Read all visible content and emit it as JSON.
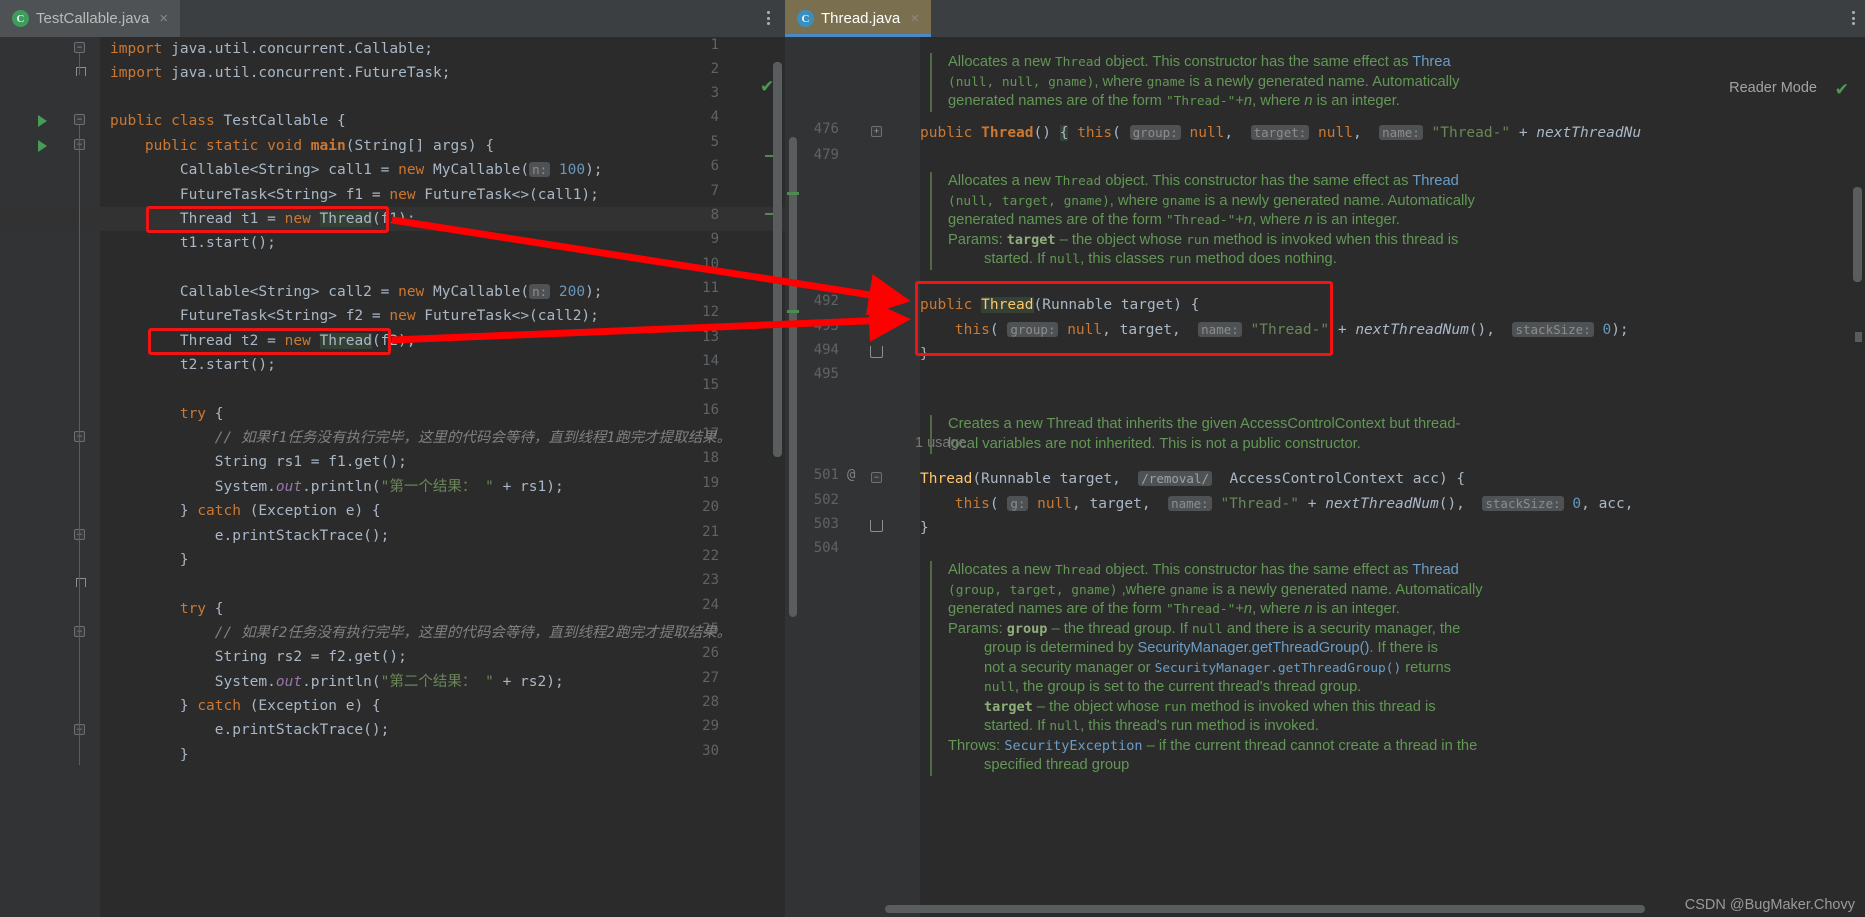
{
  "window": {
    "left_tab": {
      "label": "TestCallable.java",
      "icon": "java-class-icon",
      "close": "×"
    },
    "right_tab": {
      "label": "Thread.java",
      "icon": "java-class-icon",
      "close": "×"
    },
    "reader_mode_label": "Reader Mode",
    "inspection_ok_icon": "✔",
    "watermark": "CSDN @BugMaker.Chovy"
  },
  "left_editor": {
    "lines": [
      {
        "n": "1",
        "text": "import java.util.concurrent.Callable;"
      },
      {
        "n": "2",
        "text": "import java.util.concurrent.FutureTask;"
      },
      {
        "n": "3",
        "text": ""
      },
      {
        "n": "4",
        "text": "public class TestCallable {"
      },
      {
        "n": "5",
        "text": "    public static void main(String[] args) {"
      },
      {
        "n": "6",
        "text": "        Callable<String> call1 = new MyCallable( n: 100);"
      },
      {
        "n": "7",
        "text": "        FutureTask<String> f1 = new FutureTask<>(call1);"
      },
      {
        "n": "8",
        "text": "        Thread t1 = new Thread(f1);"
      },
      {
        "n": "9",
        "text": "        t1.start();"
      },
      {
        "n": "10",
        "text": ""
      },
      {
        "n": "11",
        "text": "        Callable<String> call2 = new MyCallable( n: 200);"
      },
      {
        "n": "12",
        "text": "        FutureTask<String> f2 = new FutureTask<>(call2);"
      },
      {
        "n": "13",
        "text": "        Thread t2 = new Thread(f2);"
      },
      {
        "n": "14",
        "text": "        t2.start();"
      },
      {
        "n": "15",
        "text": ""
      },
      {
        "n": "16",
        "text": "        try {"
      },
      {
        "n": "17",
        "text": "            // 如果f1任务没有执行完毕，这里的代码会等待，直到线程1跑完才提取结果。"
      },
      {
        "n": "18",
        "text": "            String rs1 = f1.get();"
      },
      {
        "n": "19",
        "text": "            System.out.println(\"第一个结果： \" + rs1);"
      },
      {
        "n": "20",
        "text": "        } catch (Exception e) {"
      },
      {
        "n": "21",
        "text": "            e.printStackTrace();"
      },
      {
        "n": "22",
        "text": "        }"
      },
      {
        "n": "23",
        "text": ""
      },
      {
        "n": "24",
        "text": "        try {"
      },
      {
        "n": "25",
        "text": "            // 如果f2任务没有执行完毕，这里的代码会等待，直到线程2跑完才提取结果。"
      },
      {
        "n": "26",
        "text": "            String rs2 = f2.get();"
      },
      {
        "n": "27",
        "text": "            System.out.println(\"第二个结果： \" + rs2);"
      },
      {
        "n": "28",
        "text": "        } catch (Exception e) {"
      },
      {
        "n": "29",
        "text": "            e.printStackTrace();"
      },
      {
        "n": "30",
        "text": "        }"
      }
    ]
  },
  "right_editor": {
    "line_numbers": [
      "476",
      "479",
      "492",
      "493",
      "494",
      "495",
      "501",
      "502",
      "503",
      "504"
    ],
    "code_lines": {
      "476": "public Thread() { this( group: null,  target: null,  name: \"Thread-\" + nextThreadNu",
      "492": "public Thread(Runnable target) {",
      "493": "    this( group: null, target,  name: \"Thread-\" + nextThreadNum(),  stackSize: 0);",
      "494": "}",
      "501": "Thread(Runnable target,  /removal/  AccessControlContext acc) {",
      "502": "    this( g: null, target,  name: \"Thread-\" + nextThreadNum(),  stackSize: 0, acc,",
      "503": "}"
    },
    "docs": [
      {
        "id": "doc-1",
        "lines": [
          "Allocates a new Thread object. This constructor has the same effect as Thread",
          "(null, null, gname), where gname is a newly generated name. Automatically",
          "generated names are of the form \"Thread-\"+n, where n is an integer."
        ]
      },
      {
        "id": "doc-2",
        "lines": [
          "Allocates a new Thread object. This constructor has the same effect as Thread",
          "(null, target, gname), where gname is a newly generated name. Automatically",
          "generated names are of the form \"Thread-\"+n, where n is an integer.",
          "Params: target – the object whose run method is invoked when this thread is",
          "started. If null, this classes run method does nothing."
        ]
      },
      {
        "id": "doc-3",
        "lines": [
          "Creates a new Thread that inherits the given AccessControlContext but thread-",
          "local variables are not inherited. This is not a public constructor."
        ]
      },
      {
        "id": "doc-4",
        "lines": [
          "Allocates a new Thread object. This constructor has the same effect as Thread",
          "(group, target, gname) ,where gname is a newly generated name. Automatically",
          "generated names are of the form \"Thread-\"+n, where n is an integer.",
          "Params: group – the thread group. If null and there is a security manager, the",
          "group is determined by SecurityManager.getThreadGroup(). If there is",
          "not a security manager or SecurityManager.getThreadGroup() returns",
          "null, the group is set to the current thread's thread group.",
          "target – the object whose run method is invoked when this thread is",
          "started. If null, this thread's run method is invoked.",
          "Throws: SecurityException – if the current thread cannot create a thread in the",
          "specified thread group"
        ]
      }
    ],
    "usage_label": "1 usage"
  },
  "annotations": {
    "redbox_color": "#f01414",
    "arrow_color": "#fe0000",
    "boxes": [
      {
        "name": "highlight-thread-t1",
        "label": "Thread t1 = new Thread(f1);"
      },
      {
        "name": "highlight-thread-t2",
        "label": "Thread t2 = new Thread(f2);"
      },
      {
        "name": "highlight-thread-runnable-ctor",
        "label": "public Thread(Runnable target) { ... }"
      }
    ]
  }
}
